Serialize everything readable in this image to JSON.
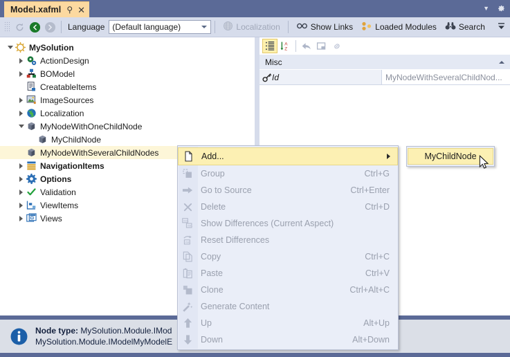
{
  "window": {
    "tab_title": "Model.xafml",
    "pin_icon": "pin-icon",
    "close_icon": "close-icon",
    "dropdown_icon": "chevron-down-icon",
    "settings_icon": "gear-icon"
  },
  "toolbar": {
    "refresh_icon": "refresh-icon",
    "back_icon": "back-arrow-icon",
    "forward_icon": "forward-arrow-icon",
    "language_label": "Language",
    "language_value": "(Default language)",
    "localization_label": "Localization",
    "show_links_label": "Show Links",
    "loaded_modules_label": "Loaded Modules",
    "search_label": "Search",
    "overflow_icon": "toolbar-overflow-icon"
  },
  "tree": {
    "nodes": [
      {
        "label": "MySolution",
        "indent": 0,
        "expander": "expanded",
        "icon": "solution-gear-icon",
        "bold": true,
        "selected": false
      },
      {
        "label": "ActionDesign",
        "indent": 1,
        "expander": "collapsed",
        "icon": "action-design-icon",
        "bold": false,
        "selected": false
      },
      {
        "label": "BOModel",
        "indent": 1,
        "expander": "collapsed",
        "icon": "bomodel-icon",
        "bold": false,
        "selected": false
      },
      {
        "label": "CreatableItems",
        "indent": 1,
        "expander": "none",
        "icon": "creatable-items-icon",
        "bold": false,
        "selected": false
      },
      {
        "label": "ImageSources",
        "indent": 1,
        "expander": "collapsed",
        "icon": "image-sources-icon",
        "bold": false,
        "selected": false
      },
      {
        "label": "Localization",
        "indent": 1,
        "expander": "collapsed",
        "icon": "globe-icon",
        "bold": false,
        "selected": false
      },
      {
        "label": "MyNodeWithOneChildNode",
        "indent": 1,
        "expander": "expanded",
        "icon": "cube-icon",
        "bold": false,
        "selected": false
      },
      {
        "label": "MyChildNode",
        "indent": 2,
        "expander": "none",
        "icon": "cube-icon",
        "bold": false,
        "selected": false
      },
      {
        "label": "MyNodeWithSeveralChildNodes",
        "indent": 1,
        "expander": "none",
        "icon": "cube-icon",
        "bold": false,
        "selected": true
      },
      {
        "label": "NavigationItems",
        "indent": 1,
        "expander": "collapsed",
        "icon": "navigation-items-icon",
        "bold": true,
        "selected": false
      },
      {
        "label": "Options",
        "indent": 1,
        "expander": "collapsed",
        "icon": "options-gear-icon",
        "bold": true,
        "selected": false
      },
      {
        "label": "Validation",
        "indent": 1,
        "expander": "collapsed",
        "icon": "check-icon",
        "bold": false,
        "selected": false
      },
      {
        "label": "ViewItems",
        "indent": 1,
        "expander": "collapsed",
        "icon": "view-items-icon",
        "bold": false,
        "selected": false
      },
      {
        "label": "Views",
        "indent": 1,
        "expander": "collapsed",
        "icon": "views-icon",
        "bold": false,
        "selected": false
      }
    ]
  },
  "property_grid": {
    "categorized_icon": "categorized-view-icon",
    "alphabetical_icon": "sort-alphabetical-icon",
    "reset_icon": "reset-arrow-icon",
    "window_icon": "property-window-icon",
    "link_icon": "link-icon",
    "category_label": "Misc",
    "category_toggle_icon": "chevron-up-icon",
    "rows": [
      {
        "icon": "key-icon",
        "name": "Id",
        "value": "MyNodeWithSeveralChildNod..."
      }
    ]
  },
  "context_menu": {
    "items": [
      {
        "label": "Add...",
        "accel": "",
        "icon": "new-document-icon",
        "highlight": true,
        "submenu": true
      },
      {
        "label": "Group",
        "accel": "Ctrl+G",
        "icon": "group-icon",
        "highlight": false,
        "submenu": false
      },
      {
        "label": "Go to Source",
        "accel": "Ctrl+Enter",
        "icon": "go-to-source-icon",
        "highlight": false,
        "submenu": false
      },
      {
        "label": "Delete",
        "accel": "Ctrl+D",
        "icon": "delete-x-icon",
        "highlight": false,
        "submenu": false
      },
      {
        "label": "Show Differences (Current Aspect)",
        "accel": "",
        "icon": "show-differences-icon",
        "highlight": false,
        "submenu": false
      },
      {
        "label": "Reset Differences",
        "accel": "",
        "icon": "reset-differences-icon",
        "highlight": false,
        "submenu": false
      },
      {
        "label": "Copy",
        "accel": "Ctrl+C",
        "icon": "copy-icon",
        "highlight": false,
        "submenu": false
      },
      {
        "label": "Paste",
        "accel": "Ctrl+V",
        "icon": "paste-icon",
        "highlight": false,
        "submenu": false
      },
      {
        "label": "Clone",
        "accel": "Ctrl+Alt+C",
        "icon": "clone-icon",
        "highlight": false,
        "submenu": false
      },
      {
        "label": "Generate Content",
        "accel": "",
        "icon": "generate-content-icon",
        "highlight": false,
        "submenu": false
      },
      {
        "label": "Up",
        "accel": "Alt+Up",
        "icon": "arrow-up-icon",
        "highlight": false,
        "submenu": false
      },
      {
        "label": "Down",
        "accel": "Alt+Down",
        "icon": "arrow-down-icon",
        "highlight": false,
        "submenu": false
      }
    ]
  },
  "submenu": {
    "items": [
      {
        "label": "MyChildNode"
      }
    ]
  },
  "status": {
    "icon": "info-icon",
    "line1_label": "Node type:",
    "line1_value": "MySolution.Module.IMod",
    "line2_value": "MySolution.Module.IModelMyModelE"
  },
  "colors": {
    "window_frame": "#5b6a97",
    "tab_active": "#fcd9a0",
    "toolbar_bg": "#d6dceb",
    "selection": "#fdf6d8",
    "menu_bg": "#eaeef8",
    "menu_highlight": "#fcf0b3",
    "status_bg": "#dbdfe7"
  }
}
